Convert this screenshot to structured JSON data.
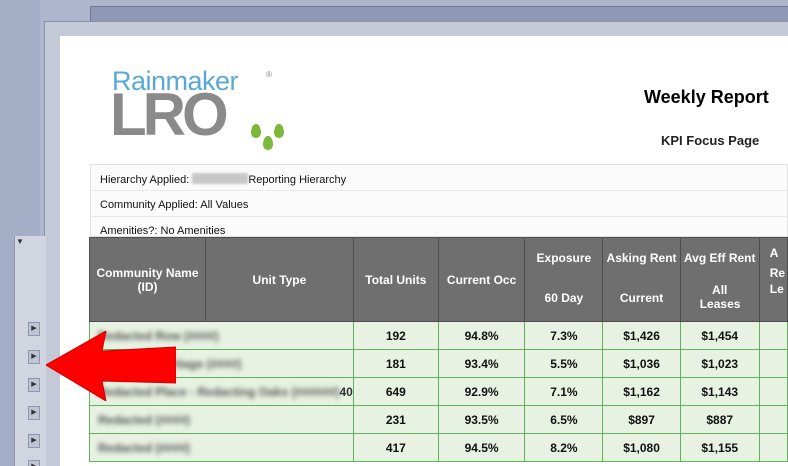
{
  "report": {
    "title": "Weekly Report",
    "subtitle": "KPI Focus Page"
  },
  "logo": {
    "line1": "Rainmaker",
    "line2": "LRO",
    "reg_mark": "®"
  },
  "filters": {
    "hierarchy_label": "Hierarchy Applied:",
    "hierarchy_value": "Reporting Hierarchy",
    "community_label": "Community Applied:",
    "community_value": "All Values",
    "amenities_label": "Amenities?:",
    "amenities_value": "No Amenities"
  },
  "table": {
    "headers": {
      "community": "Community Name (ID)",
      "unit_type": "Unit Type",
      "total_units": "Total Units",
      "current_occ": "Current Occ",
      "exposure_top": "Exposure",
      "exposure_bot": "60 Day",
      "asking_top": "Asking Rent",
      "asking_bot": "Current",
      "avg_top": "Avg Eff Rent",
      "avg_bot": "All Leases",
      "next_top": "A",
      "next_mid": "Re",
      "next_bot": "Le"
    },
    "rows": [
      {
        "community": "Redacted Row (####)",
        "total_units": "192",
        "current_occ": "94.8%",
        "exposure": "7.3%",
        "asking": "$1,426",
        "avg": "$1,454"
      },
      {
        "community": "Redacted Heritage (####)",
        "total_units": "181",
        "current_occ": "93.4%",
        "exposure": "5.5%",
        "asking": "$1,036",
        "avg": "$1,023"
      },
      {
        "community": "Redacted Place - Redacting Oaks (######)",
        "trail": "40",
        "total_units": "649",
        "current_occ": "92.9%",
        "exposure": "7.1%",
        "asking": "$1,162",
        "avg": "$1,143"
      },
      {
        "community": "Redacted (####)",
        "total_units": "231",
        "current_occ": "93.5%",
        "exposure": "6.5%",
        "asking": "$897",
        "avg": "$887"
      },
      {
        "community": "Redacted (####)",
        "total_units": "417",
        "current_occ": "94.5%",
        "exposure": "8.2%",
        "asking": "$1,080",
        "avg": "$1,155"
      }
    ]
  },
  "colors": {
    "header_bg": "#6f6f6f",
    "row_bg": "#e7f2e2",
    "row_border": "#5fb35a",
    "arrow": "#ff0000",
    "logo_blue": "#59a9d6",
    "logo_gray": "#8a8a8a",
    "logo_green": "#7cb839"
  },
  "icons": {
    "annotation": "red-arrow-left",
    "dropdown": "triangle-down-icon",
    "row_expander": "triangle-right-icon"
  }
}
